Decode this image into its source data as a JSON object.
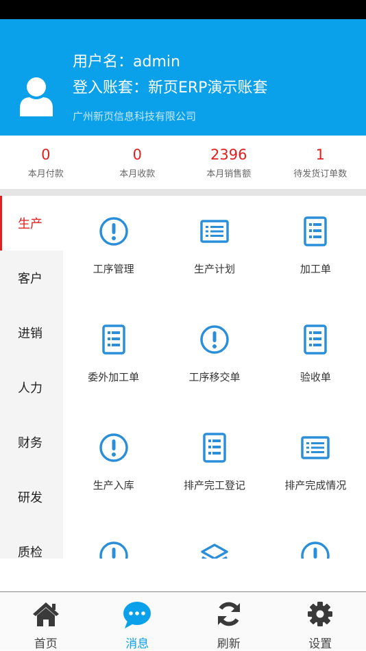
{
  "profile": {
    "username_label": "用户名：admin",
    "account_label": "登入账套：新页ERP演示账套",
    "company": "广州新页信息科技有限公司"
  },
  "stats": [
    {
      "value": "0",
      "label": "本月付款"
    },
    {
      "value": "0",
      "label": "本月收款"
    },
    {
      "value": "2396",
      "label": "本月销售额"
    },
    {
      "value": "1",
      "label": "待发货订单数"
    }
  ],
  "sidebar": {
    "items": [
      {
        "label": "生产",
        "active": true
      },
      {
        "label": "客户"
      },
      {
        "label": "进销"
      },
      {
        "label": "人力"
      },
      {
        "label": "财务"
      },
      {
        "label": "研发"
      },
      {
        "label": "质检"
      }
    ]
  },
  "grid": {
    "items": [
      {
        "label": "工序管理",
        "icon": "exclamation-circle-icon"
      },
      {
        "label": "生产计划",
        "icon": "list-icon"
      },
      {
        "label": "加工单",
        "icon": "document-icon"
      },
      {
        "label": "委外加工单",
        "icon": "document-icon"
      },
      {
        "label": "工序移交单",
        "icon": "exclamation-circle-icon"
      },
      {
        "label": "验收单",
        "icon": "document-icon"
      },
      {
        "label": "生产入库",
        "icon": "exclamation-circle-icon"
      },
      {
        "label": "排产完工登记",
        "icon": "document-icon"
      },
      {
        "label": "排产完成情况",
        "icon": "list-icon"
      },
      {
        "label": "",
        "icon": "exclamation-circle-icon"
      },
      {
        "label": "",
        "icon": "layers-icon"
      },
      {
        "label": "",
        "icon": "exclamation-circle-icon"
      }
    ]
  },
  "tabbar": [
    {
      "label": "首页",
      "icon": "home-icon"
    },
    {
      "label": "消息",
      "icon": "chat-bubble-icon",
      "active": true
    },
    {
      "label": "刷新",
      "icon": "refresh-icon"
    },
    {
      "label": "设置",
      "icon": "gear-icon"
    }
  ],
  "colors": {
    "brand": "#0aa1ea",
    "accent": "#e0201e",
    "icon": "#2a8fd8"
  }
}
